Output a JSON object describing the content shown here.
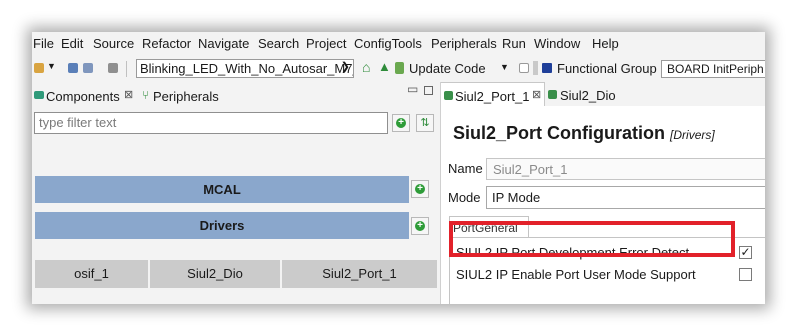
{
  "menu": [
    "File",
    "Edit",
    "Source",
    "Refactor",
    "Navigate",
    "Search",
    "Project",
    "ConfigTools",
    "Peripherals",
    "Run",
    "Window",
    "Help"
  ],
  "toolbar": {
    "project_combo": "Blinking_LED_With_No_Autosar_M7_",
    "update_code": "Update Code",
    "functional_group": "Functional Group",
    "board": "BOARD InitPeriph"
  },
  "left_panel": {
    "tab_components": "Components",
    "tab_peripherals": "Peripherals",
    "filter_placeholder": "type filter text",
    "groups": [
      "MCAL",
      "Drivers"
    ],
    "components": [
      "osif_1",
      "Siul2_Dio",
      "Siul2_Port_1"
    ]
  },
  "right_panel": {
    "tab_port": "Siul2_Port_1",
    "tab_dio": "Siul2_Dio",
    "title": "Siul2_Port Configuration",
    "title_sub": "[Drivers]",
    "name_label": "Name",
    "name_value": "Siul2_Port_1",
    "mode_label": "Mode",
    "mode_value": "IP Mode",
    "section_tab": "PortGeneral",
    "options": [
      {
        "label": "SIUL2 IP Port Development Error Detect",
        "checked": true
      },
      {
        "label": "SIUL2 IP Enable Port User Mode Support",
        "checked": false
      }
    ]
  },
  "colors": {
    "group_bar": "#8aa7cc",
    "highlight": "#e2212a",
    "add_button": "#2e9c38"
  }
}
